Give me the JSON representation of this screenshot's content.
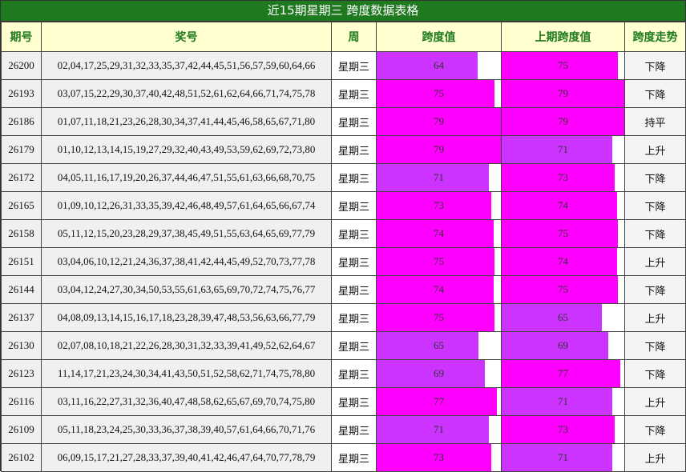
{
  "title": "近15期星期三 跨度数据表格",
  "headers": {
    "period": "期号",
    "numbers": "奖号",
    "week": "周",
    "span": "跨度值",
    "prev_span": "上期跨度值",
    "trend": "跨度走势"
  },
  "bar_scale_max": 79,
  "colors": {
    "title_bg": "#1f7a1f",
    "header_bg": "#ffffd0",
    "header_text": "#1f7a1f",
    "bar_high": "#ff00ff",
    "bar_low": "#cc33ff"
  },
  "rows": [
    {
      "period": "26200",
      "numbers": "02,04,17,25,29,31,32,33,35,37,42,44,45,51,56,57,59,60,64,66",
      "week": "星期三",
      "span": "64",
      "prev_span": "75",
      "trend": "下降"
    },
    {
      "period": "26193",
      "numbers": "03,07,15,22,29,30,37,40,42,48,51,52,61,62,64,66,71,74,75,78",
      "week": "星期三",
      "span": "75",
      "prev_span": "79",
      "trend": "下降"
    },
    {
      "period": "26186",
      "numbers": "01,07,11,18,21,23,26,28,30,34,37,41,44,45,46,58,65,67,71,80",
      "week": "星期三",
      "span": "79",
      "prev_span": "79",
      "trend": "持平"
    },
    {
      "period": "26179",
      "numbers": "01,10,12,13,14,15,19,27,29,32,40,43,49,53,59,62,69,72,73,80",
      "week": "星期三",
      "span": "79",
      "prev_span": "71",
      "trend": "上升"
    },
    {
      "period": "26172",
      "numbers": "04,05,11,16,17,19,20,26,37,44,46,47,51,55,61,63,66,68,70,75",
      "week": "星期三",
      "span": "71",
      "prev_span": "73",
      "trend": "下降"
    },
    {
      "period": "26165",
      "numbers": "01,09,10,12,26,31,33,35,39,42,46,48,49,57,61,64,65,66,67,74",
      "week": "星期三",
      "span": "73",
      "prev_span": "74",
      "trend": "下降"
    },
    {
      "period": "26158",
      "numbers": "05,11,12,15,20,23,28,29,37,38,45,49,51,55,63,64,65,69,77,79",
      "week": "星期三",
      "span": "74",
      "prev_span": "75",
      "trend": "下降"
    },
    {
      "period": "26151",
      "numbers": "03,04,06,10,12,21,24,36,37,38,41,42,44,45,49,52,70,73,77,78",
      "week": "星期三",
      "span": "75",
      "prev_span": "74",
      "trend": "上升"
    },
    {
      "period": "26144",
      "numbers": "03,04,12,24,27,30,34,50,53,55,61,63,65,69,70,72,74,75,76,77",
      "week": "星期三",
      "span": "74",
      "prev_span": "75",
      "trend": "下降"
    },
    {
      "period": "26137",
      "numbers": "04,08,09,13,14,15,16,17,18,23,28,39,47,48,53,56,63,66,77,79",
      "week": "星期三",
      "span": "75",
      "prev_span": "65",
      "trend": "上升"
    },
    {
      "period": "26130",
      "numbers": "02,07,08,10,18,21,22,26,28,30,31,32,33,39,41,49,52,62,64,67",
      "week": "星期三",
      "span": "65",
      "prev_span": "69",
      "trend": "下降"
    },
    {
      "period": "26123",
      "numbers": "11,14,17,21,23,24,30,34,41,43,50,51,52,58,62,71,74,75,78,80",
      "week": "星期三",
      "span": "69",
      "prev_span": "77",
      "trend": "下降"
    },
    {
      "period": "26116",
      "numbers": "03,11,16,22,27,31,32,36,40,47,48,58,62,65,67,69,70,74,75,80",
      "week": "星期三",
      "span": "77",
      "prev_span": "71",
      "trend": "上升"
    },
    {
      "period": "26109",
      "numbers": "05,11,18,23,24,25,30,33,36,37,38,39,40,57,61,64,66,70,71,76",
      "week": "星期三",
      "span": "71",
      "prev_span": "73",
      "trend": "下降"
    },
    {
      "period": "26102",
      "numbers": "06,09,15,17,21,27,28,33,37,39,40,41,42,46,47,64,70,77,78,79",
      "week": "星期三",
      "span": "73",
      "prev_span": "71",
      "trend": "上升"
    }
  ]
}
